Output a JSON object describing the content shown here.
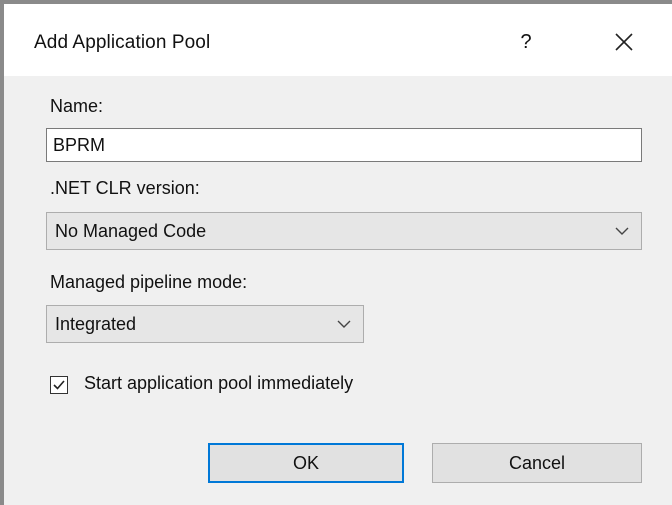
{
  "dialog": {
    "title": "Add Application Pool",
    "help_label": "?",
    "close_label": "✕"
  },
  "form": {
    "name_label": "Name:",
    "name_value": "BPRM",
    "clr_label": ".NET CLR version:",
    "clr_value": "No Managed Code",
    "pipeline_label": "Managed pipeline mode:",
    "pipeline_value": "Integrated",
    "start_label": "Start application pool immediately",
    "start_checked": true
  },
  "buttons": {
    "ok_label": "OK",
    "cancel_label": "Cancel"
  },
  "colors": {
    "accent": "#0078d7",
    "dialog_bg": "#f0f0f0"
  }
}
